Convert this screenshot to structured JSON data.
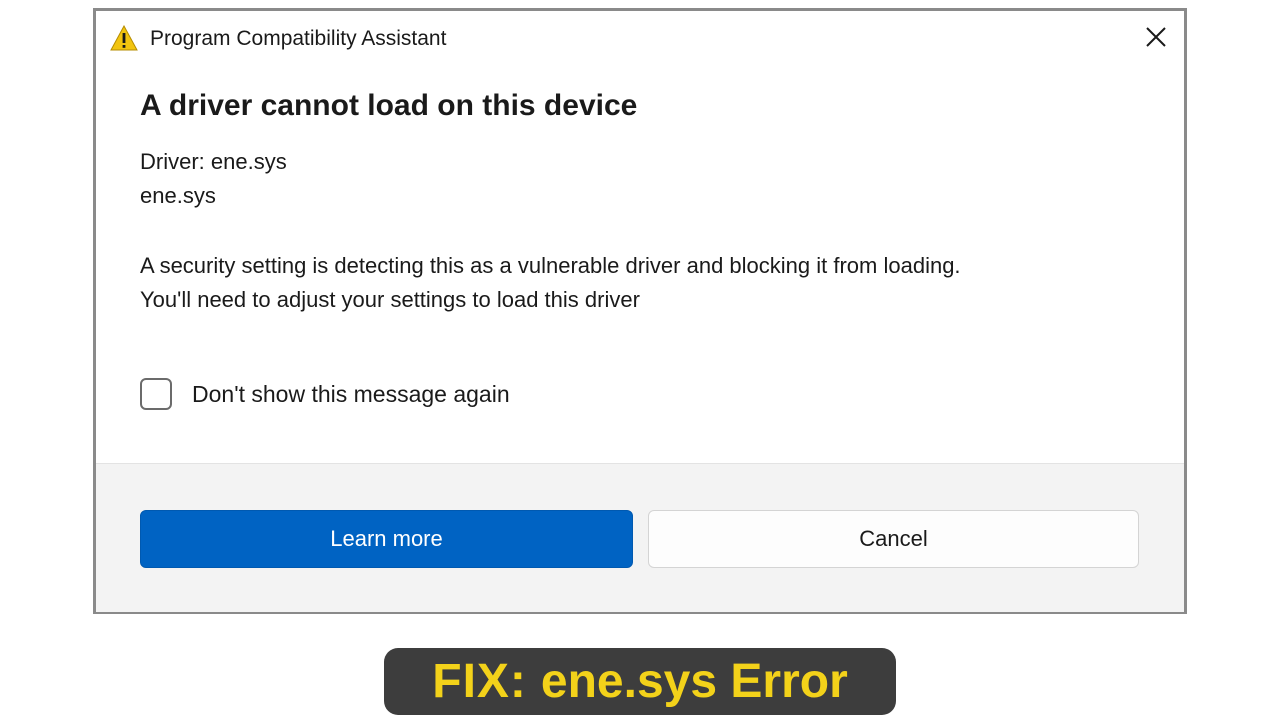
{
  "dialog": {
    "window_title": "Program Compatibility Assistant",
    "icon": "warning-icon",
    "close_icon": "close-icon",
    "heading": "A driver cannot load on this device",
    "driver_line": "Driver: ene.sys",
    "driver_name": "ene.sys",
    "message_line1": "A security setting is detecting this as a vulnerable driver and blocking it from loading.",
    "message_line2": "You'll need to adjust your settings to load this driver",
    "checkbox_label": "Don't show this message again",
    "checkbox_checked": false,
    "learn_more_label": "Learn more",
    "cancel_label": "Cancel"
  },
  "banner": {
    "fix_label": "FIX:",
    "title": "ene.sys Error"
  },
  "colors": {
    "primary_button": "#0063c3",
    "banner_bg": "#3d3d3d",
    "banner_text": "#f3d21a"
  }
}
